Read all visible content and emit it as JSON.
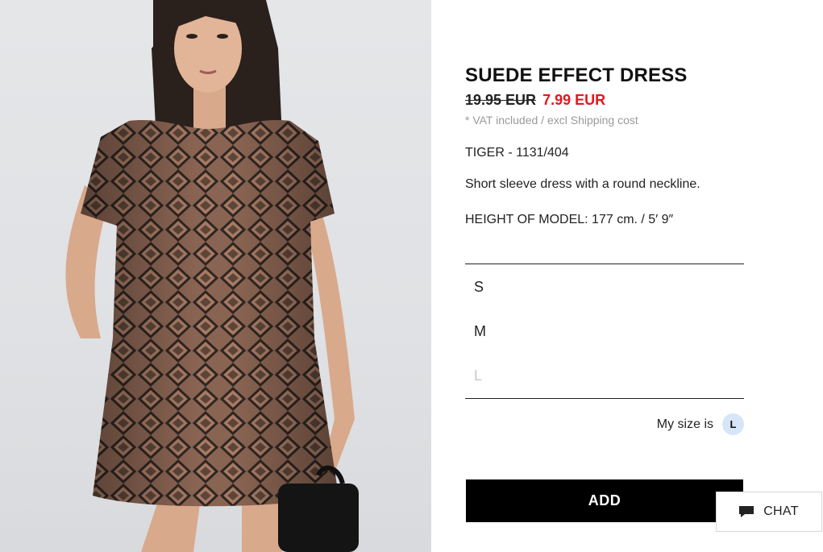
{
  "product": {
    "name": "SUEDE EFFECT DRESS",
    "old_price": "19.95 EUR",
    "sale_price": "7.99 EUR",
    "vat_note": "* VAT included / excl Shipping cost",
    "color_ref": "TIGER - 1131/404",
    "description": "Short sleeve dress with a round neckline.",
    "model_height": "HEIGHT OF MODEL: 177 cm. / 5′ 9″"
  },
  "sizes": [
    {
      "label": "S",
      "available": true
    },
    {
      "label": "M",
      "available": true
    },
    {
      "label": "L",
      "available": false
    }
  ],
  "my_size": {
    "label": "My size is",
    "value": "L"
  },
  "add_button": "ADD",
  "chat": {
    "label": "CHAT",
    "icon": "speech-bubble-icon"
  },
  "colors": {
    "sale_price": "#e8151b",
    "add_button_bg": "#000000",
    "my_size_badge_bg": "#d6e6f7"
  }
}
